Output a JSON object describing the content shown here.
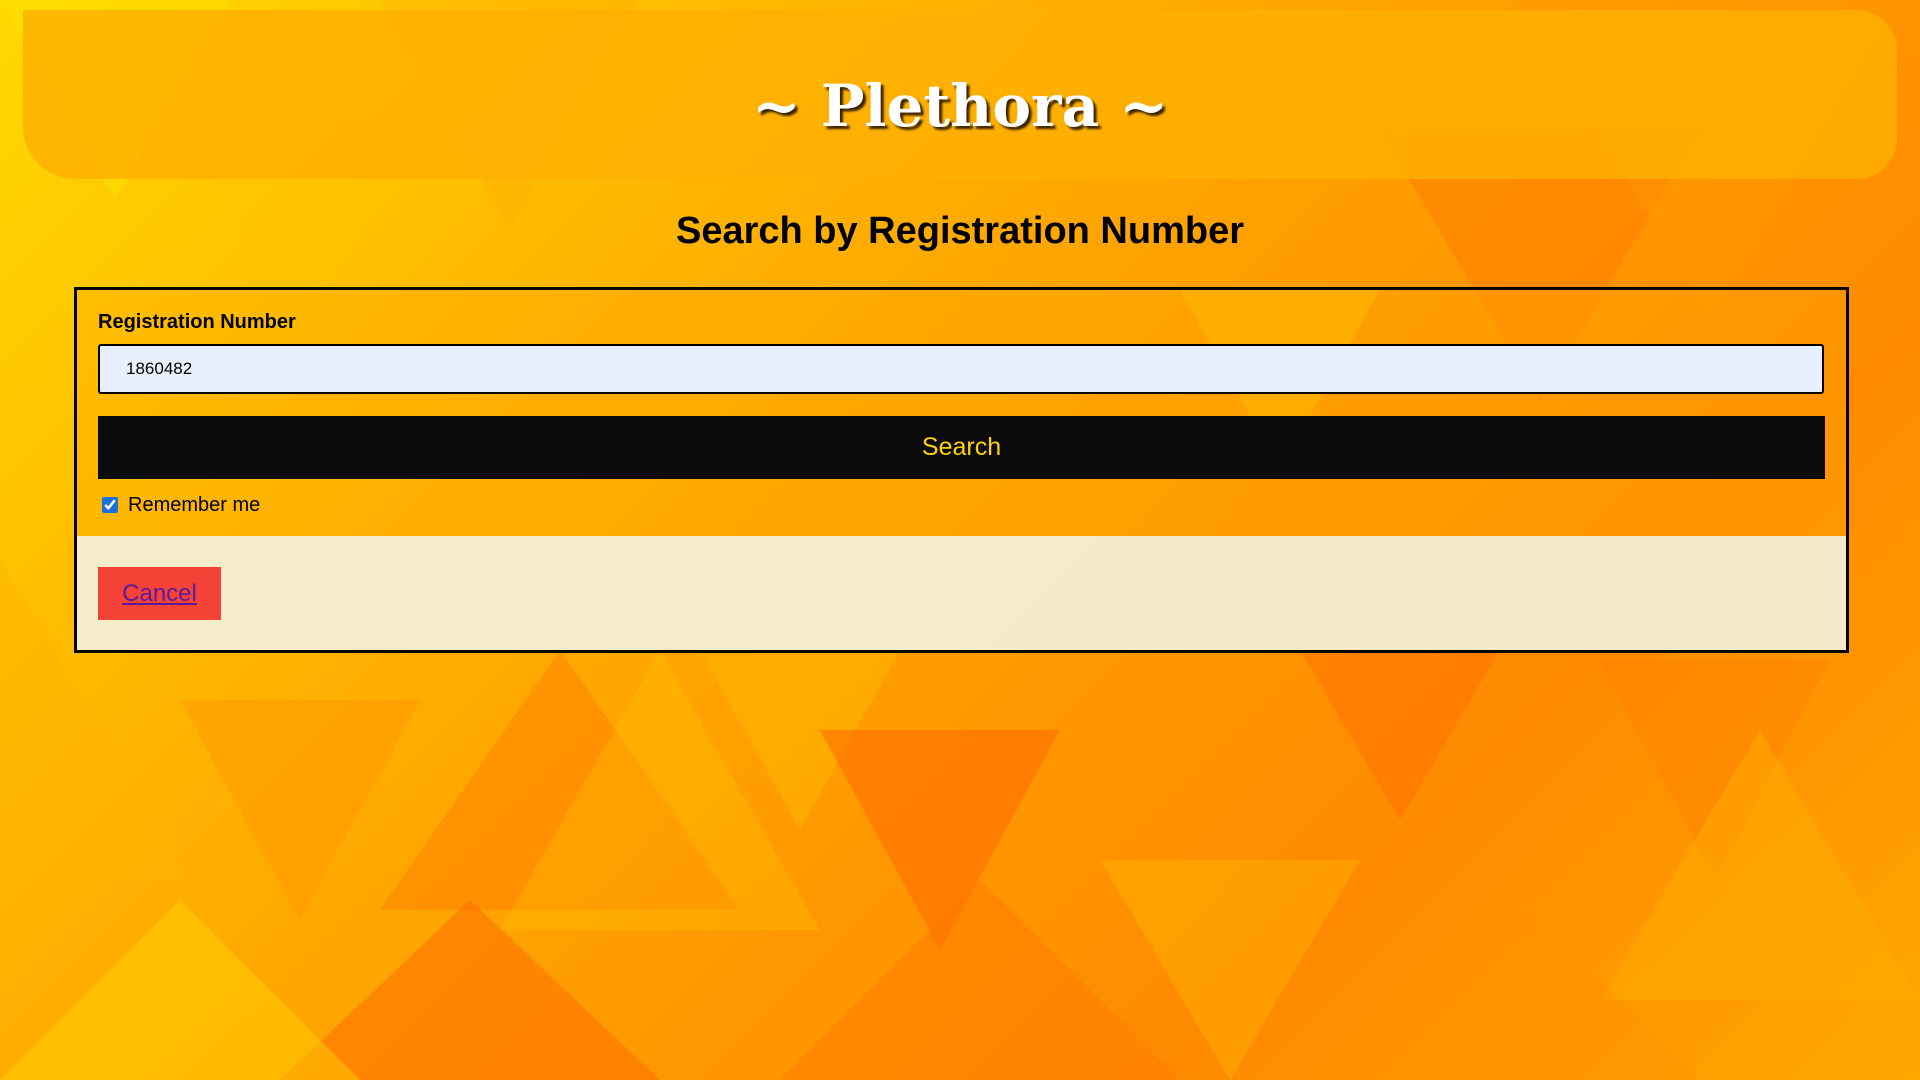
{
  "header": {
    "site_title": "~ Plethora ~"
  },
  "page": {
    "title": "Search by Registration Number"
  },
  "form": {
    "field_label": "Registration Number",
    "registration_value": "1860482",
    "search_label": "Search",
    "remember_label": "Remember me",
    "remember_checked": true,
    "cancel_label": "Cancel"
  },
  "colors": {
    "search_button_bg": "#0b0b0b",
    "search_button_text": "#ffd400",
    "cancel_button_bg": "#f44336",
    "input_bg": "#e8f0fe"
  }
}
